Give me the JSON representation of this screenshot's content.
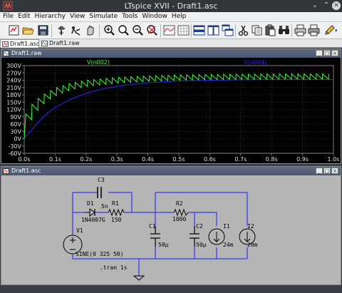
{
  "window": {
    "title": "LTspice XVII - Draft1.asc"
  },
  "menu": [
    "File",
    "Edit",
    "Hierarchy",
    "View",
    "Simulate",
    "Tools",
    "Window",
    "Help"
  ],
  "toolbar_icons": [
    "new-schematic-icon",
    "open-folder-icon",
    "save-icon",
    "control-panel-icon",
    "run-icon",
    "halt-icon",
    "zoom-in-icon",
    "zoom-pan-icon",
    "zoom-out-icon",
    "zoom-fit-icon",
    "autorange-icon",
    "grid-icon",
    "tile-horizontal-icon",
    "tile-vertical-icon",
    "cascade-icon",
    "cut-icon",
    "copy-icon",
    "paste-icon",
    "find-icon",
    "print-icon",
    "print-setup-icon",
    "pencil-icon"
  ],
  "tabs": [
    {
      "label": "Draft1.asc",
      "active": true
    },
    {
      "label": "Draft1.raw",
      "active": false
    }
  ],
  "plot_window": {
    "title": "Draft1.raw"
  },
  "schematic_window": {
    "title": "Draft1.asc"
  },
  "colors": {
    "v_n002": "#33ff33",
    "v_n004": "#2828ff",
    "wire": "#1a1aff",
    "component": "#000000"
  },
  "chart_data": {
    "type": "line",
    "xlim": [
      0,
      1.0
    ],
    "ylim": [
      -60,
      300
    ],
    "x_ticks": [
      "0.0s",
      "0.1s",
      "0.2s",
      "0.3s",
      "0.4s",
      "0.5s",
      "0.6s",
      "0.7s",
      "0.8s",
      "0.9s",
      "1.0s"
    ],
    "y_ticks": [
      "300V",
      "270V",
      "240V",
      "210V",
      "180V",
      "150V",
      "120V",
      "90V",
      "60V",
      "30V",
      "0V",
      "-30V",
      "-60V"
    ],
    "series": [
      {
        "name": "V(n002)",
        "description_values": "sawtooth ripple: rises at each AC peak (every 0.02s), decays between",
        "x": [
          0.0,
          0.02,
          0.04,
          0.06,
          0.08,
          0.1,
          0.15,
          0.2,
          0.3,
          0.4,
          0.5,
          0.6,
          0.7,
          0.8,
          0.9,
          1.0
        ],
        "peak": [
          90,
          135,
          160,
          180,
          195,
          208,
          228,
          240,
          252,
          258,
          262,
          264,
          265,
          266,
          266,
          266
        ],
        "trough": [
          0,
          70,
          110,
          140,
          160,
          175,
          200,
          214,
          228,
          235,
          240,
          242,
          243,
          244,
          244,
          244
        ]
      },
      {
        "name": "V(n004)",
        "x": [
          0.0,
          0.02,
          0.04,
          0.06,
          0.08,
          0.1,
          0.15,
          0.2,
          0.25,
          0.3,
          0.4,
          0.5,
          0.6,
          0.7,
          0.8,
          0.9,
          1.0
        ],
        "values": [
          0,
          30,
          60,
          88,
          110,
          128,
          162,
          186,
          203,
          215,
          230,
          237,
          240,
          242,
          243,
          243,
          243
        ]
      }
    ]
  },
  "schematic": {
    "components": {
      "c3": {
        "name": "C3",
        "value": "5n"
      },
      "d1": {
        "name": "D1",
        "value": "1N4007G"
      },
      "r1": {
        "name": "R1",
        "value": "150"
      },
      "r2": {
        "name": "R2",
        "value": "1000"
      },
      "c1": {
        "name": "C1",
        "value": "50µ"
      },
      "c2": {
        "name": "C2",
        "value": "50µ"
      },
      "v1": {
        "name": "V1",
        "value": "SINE(0 325 50)"
      },
      "i1": {
        "name": "I1",
        "value": "24m"
      },
      "i2": {
        "name": "I2",
        "value": "20m"
      }
    },
    "directive": ".tran 1s"
  }
}
